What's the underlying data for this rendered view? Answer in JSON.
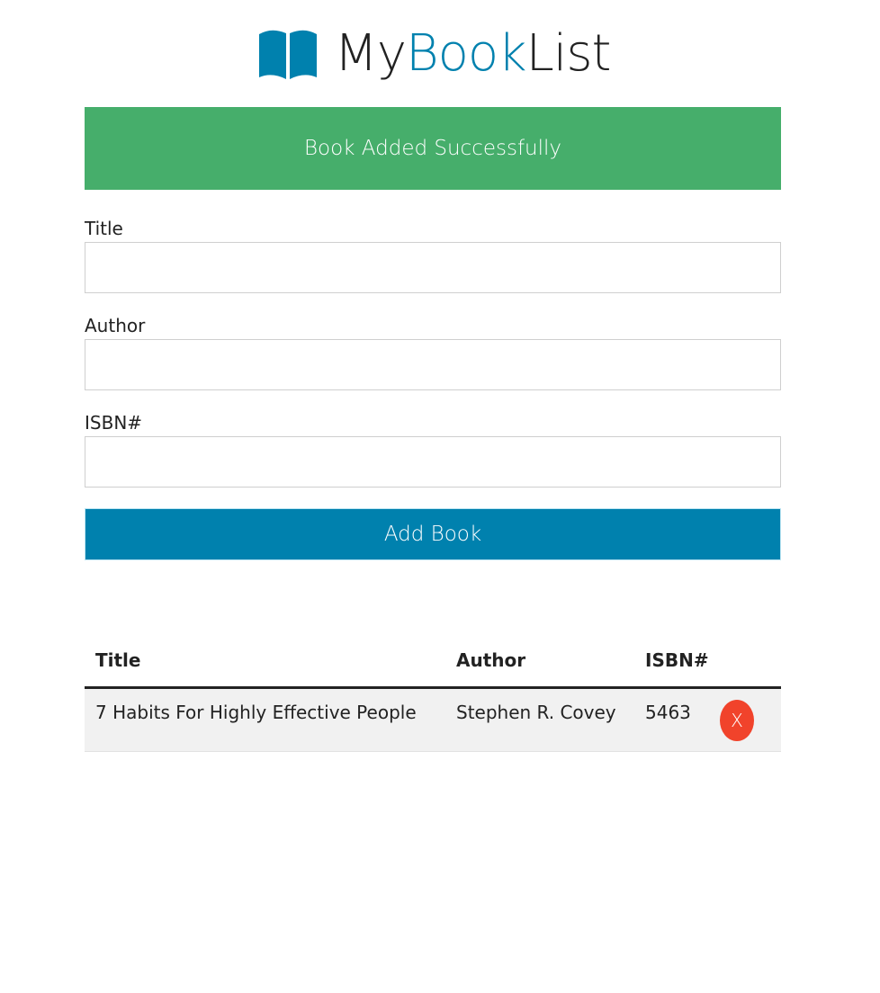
{
  "brand": {
    "part1": "My",
    "part2": "Book",
    "part3": "List",
    "icon": "open-book-icon",
    "accent_color": "#0081ae"
  },
  "alert": {
    "message": "Book Added Successfully",
    "color": "#46ae6b"
  },
  "form": {
    "title_label": "Title",
    "title_value": "",
    "author_label": "Author",
    "author_value": "",
    "isbn_label": "ISBN#",
    "isbn_value": "",
    "submit_label": "Add Book"
  },
  "table": {
    "headers": [
      "Title",
      "Author",
      "ISBN#"
    ],
    "rows": [
      {
        "title": "7 Habits For Highly Effective People",
        "author": "Stephen R. Covey",
        "isbn": "5463",
        "delete_label": "X"
      }
    ],
    "delete_color": "#f1432b"
  }
}
